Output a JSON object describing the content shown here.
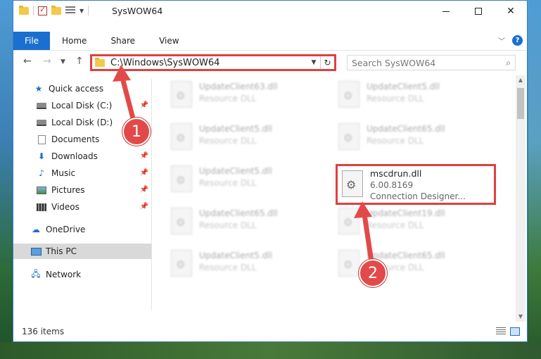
{
  "window": {
    "title": "SysWOW64"
  },
  "ribbon": {
    "tabs": [
      "File",
      "Home",
      "Share",
      "View"
    ],
    "help": "?"
  },
  "address": {
    "path": "C:\\Windows\\SysWOW64",
    "search_placeholder": "Search SysWOW64"
  },
  "nav_pane": {
    "items": [
      {
        "label": "Quick access",
        "icon": "star-icon"
      },
      {
        "label": "Local Disk (C:)",
        "icon": "disk-icon"
      },
      {
        "label": "Local Disk (D:)",
        "icon": "disk-icon"
      },
      {
        "label": "Documents",
        "icon": "document-icon"
      },
      {
        "label": "Downloads",
        "icon": "download-icon"
      },
      {
        "label": "Music",
        "icon": "music-icon"
      },
      {
        "label": "Pictures",
        "icon": "pictures-icon"
      },
      {
        "label": "Videos",
        "icon": "videos-icon"
      },
      {
        "label": "OneDrive",
        "icon": "cloud-icon"
      },
      {
        "label": "This PC",
        "icon": "computer-icon"
      },
      {
        "label": "Network",
        "icon": "network-icon"
      }
    ]
  },
  "files": [
    {
      "name": "UpdateClient63.dll",
      "type": "Resource DLL"
    },
    {
      "name": "UpdateClient5.dll",
      "type": "Resource DLL"
    },
    {
      "name": "UpdateClient5.dll",
      "type": "Resource DLL"
    },
    {
      "name": "UpdateClient65.dll",
      "type": "Resource DLL"
    },
    {
      "name": "UpdateClient5.dll",
      "type": "Resource DLL"
    },
    {
      "name": "UpdateClient65.dll",
      "type": "Resource DLL"
    },
    {
      "name": "UpdateClient19.dll",
      "type": "Resource DLL"
    },
    {
      "name": "UpdateClient5.dll",
      "type": "Resource DLL"
    },
    {
      "name": "UpdateClient65.dll",
      "type": "Resource DLL"
    }
  ],
  "selected_file": {
    "name": "mscdrun.dll",
    "version": "6.00.8169",
    "description": "Connection Designer..."
  },
  "status": {
    "items_count": "136 items"
  },
  "callouts": [
    "1",
    "2"
  ],
  "colors": {
    "accent": "#1a6fd0",
    "highlight": "#e04040"
  }
}
